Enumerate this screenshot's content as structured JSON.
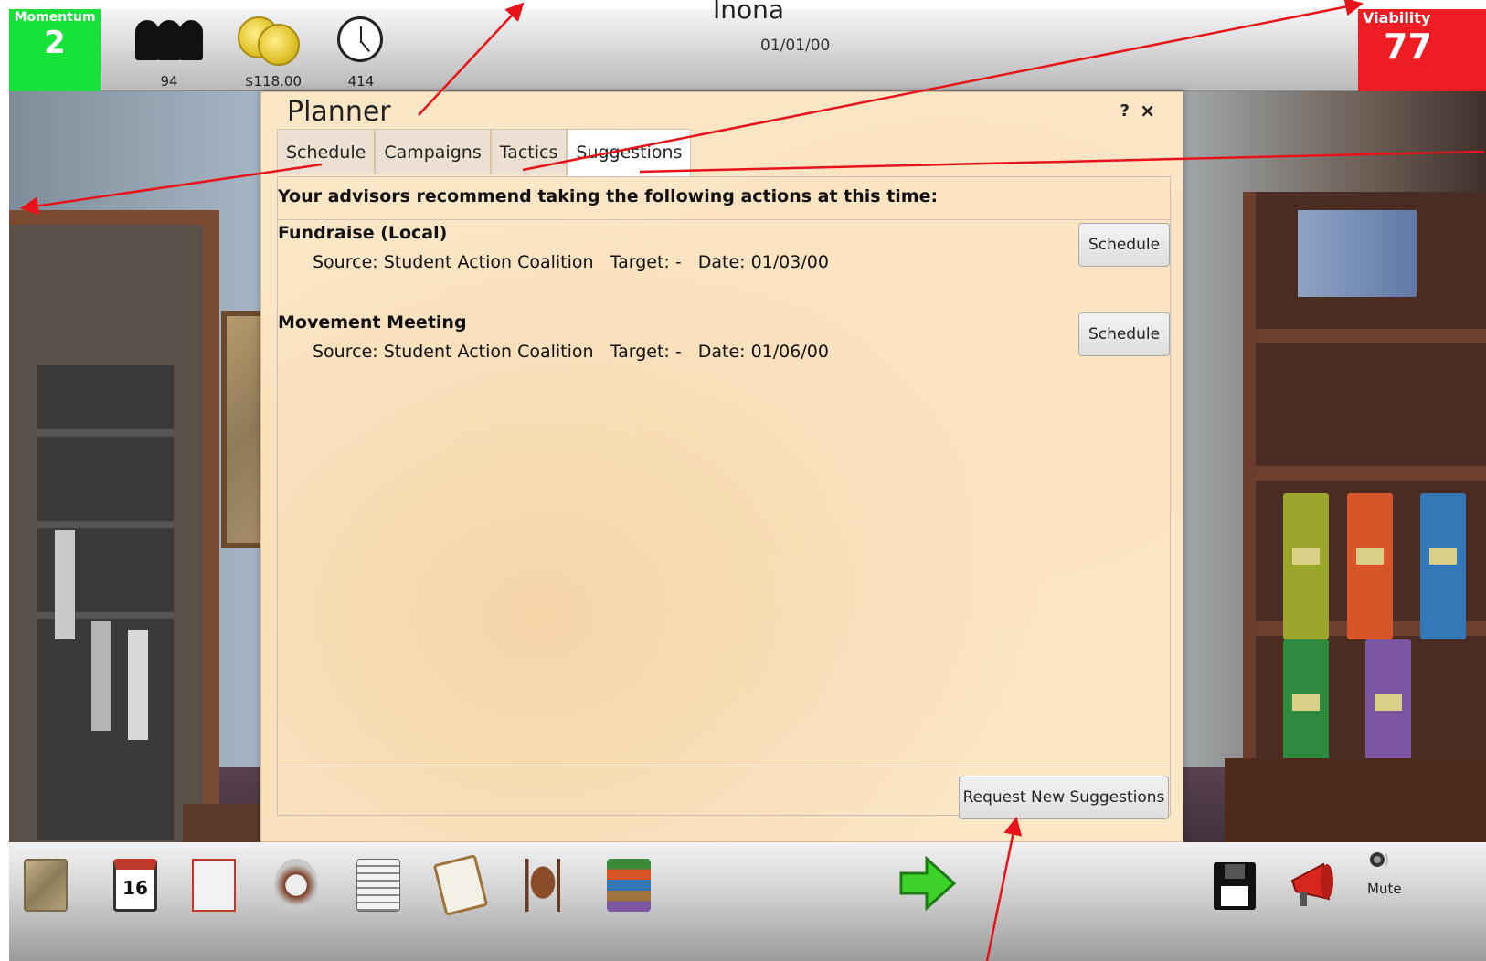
{
  "hud": {
    "momentum_label": "Momentum",
    "momentum_value": "2",
    "supporters": "94",
    "money": "$118.00",
    "time": "414",
    "title": "Inona",
    "date": "01/01/00",
    "viability_label": "Viability",
    "viability_value": "77"
  },
  "planner": {
    "title": "Planner",
    "help_label": "?",
    "close_label": "×",
    "tabs": [
      {
        "label": "Schedule"
      },
      {
        "label": "Campaigns"
      },
      {
        "label": "Tactics"
      },
      {
        "label": "Suggestions"
      }
    ],
    "active_tab": "Suggestions",
    "intro": "Your advisors recommend taking the following actions at this time:",
    "suggestions": [
      {
        "name": "Fundraise (Local)",
        "source": "Source: Student Action Coalition",
        "target": "Target: -",
        "date": "Date: 01/03/00",
        "button": "Schedule"
      },
      {
        "name": "Movement Meeting",
        "source": "Source: Student Action Coalition",
        "target": "Target: -",
        "date": "Date: 01/06/00",
        "button": "Schedule"
      }
    ],
    "request_button": "Request New Suggestions"
  },
  "toolbar": {
    "icons": [
      "map-icon",
      "calendar-icon",
      "planner-icon",
      "rolodex-icon",
      "newspaper-icon",
      "clipboard-icon",
      "meeting-table-icon",
      "binders-icon"
    ],
    "calendar_day": "16",
    "mute_label": "Mute"
  },
  "colors": {
    "momentum": "#16e33a",
    "viability": "#ee1c23",
    "annotation": "#e8131a",
    "next_arrow": "#3ed12a"
  }
}
